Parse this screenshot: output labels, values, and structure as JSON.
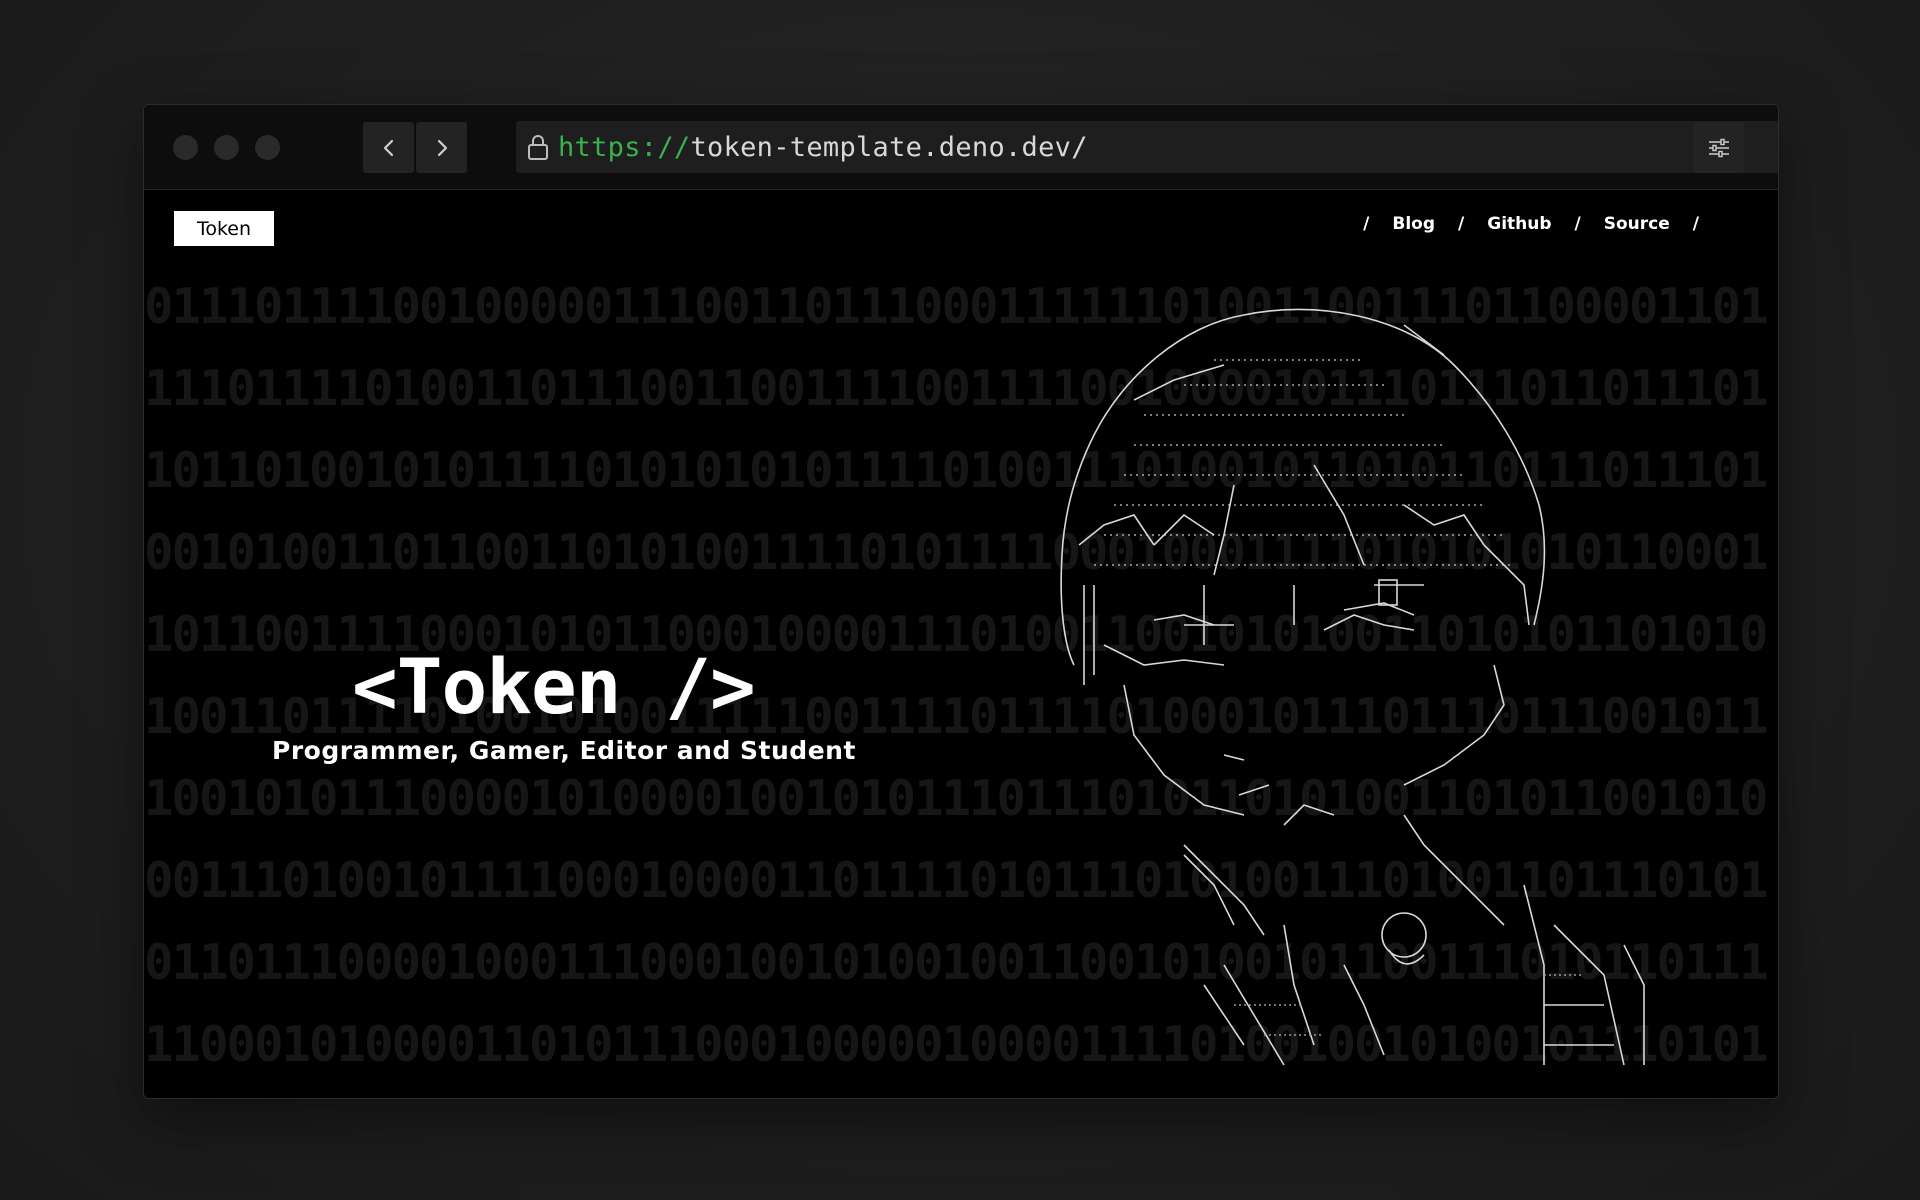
{
  "browser": {
    "url_scheme": "https://",
    "url_host": "token-template.deno.dev/"
  },
  "site": {
    "logo": "Token",
    "nav": [
      {
        "label": "Blog"
      },
      {
        "label": "Github"
      },
      {
        "label": "Source"
      }
    ],
    "nav_separator": "/",
    "hero": {
      "title": "<Token />",
      "subtitle": "Programmer, Gamer, Editor and Student"
    }
  },
  "background_binary": [
    "01110111100100000111001101110001111110100110011101100001101",
    "11101111010011011100110011110011110010000101110111011011101",
    "10110100101011110101010101111010011101001011010110111011101",
    "00101001101100110101001111010111100010001111010101010110001",
    "10110011110001010110001000011101001100101010011010101101010",
    "10011011110100101001111100111101111010001011101110111001011",
    "10010101110000101000010010101110111010110101001101011001010",
    "00111010010111100010000110111101011101010011101001101110101",
    "01101110000100011100010010100100110010100101100111010110111",
    "11000101000011010111000100000100001111010010010100101110101"
  ],
  "colors": {
    "page_bg": "#1f1f1f",
    "site_bg": "#000000",
    "url_scheme": "#37b24d",
    "binary_text": "#161616"
  }
}
